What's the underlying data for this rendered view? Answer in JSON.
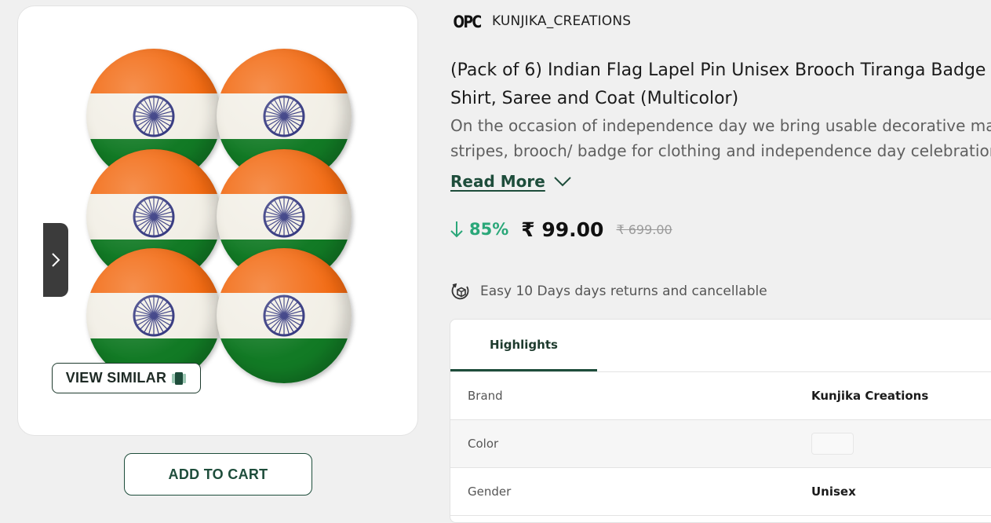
{
  "product": {
    "seller": {
      "logo_text": "OPC",
      "name": "KUNJIKA_CREATIONS"
    },
    "title_lines": [
      "(Pack of 6) Indian Flag Lapel Pin Unisex Brooch Tiranga Badge",
      "Shirt, Saree and Coat (Multicolor)"
    ],
    "description_lines": [
      "On the occasion of independence day we bring usable decorative material",
      "stripes, brooch/ badge for clothing and independence day celebrations"
    ],
    "read_more_label": "Read More",
    "discount": "85%",
    "price": "₹ 99.00",
    "mrp": "₹ 699.00",
    "returns_text": "Easy 10 Days days returns and cancellable",
    "pin_count": 6
  },
  "actions": {
    "view_similar_label": "VIEW SIMILAR",
    "add_to_cart_label": "ADD TO CART"
  },
  "highlights": {
    "tab_label": "Highlights",
    "rows": [
      {
        "label": "Brand",
        "value": "Kunjika Creations"
      },
      {
        "label": "Color",
        "value": ""
      },
      {
        "label": "Gender",
        "value": "Unisex"
      }
    ]
  },
  "colors": {
    "accent": "#1e4d3b",
    "discount": "#2aa779",
    "saffron": "#f26a12",
    "white_band": "#f2efe6",
    "green_band": "#127a25",
    "chakra": "#2b2f7a"
  },
  "icons": {
    "carousel_next": "chevron-right-icon",
    "view_similar": "similar-items-icon",
    "read_more": "chevron-down-icon",
    "discount": "arrow-down-icon",
    "returns": "return-box-icon"
  }
}
